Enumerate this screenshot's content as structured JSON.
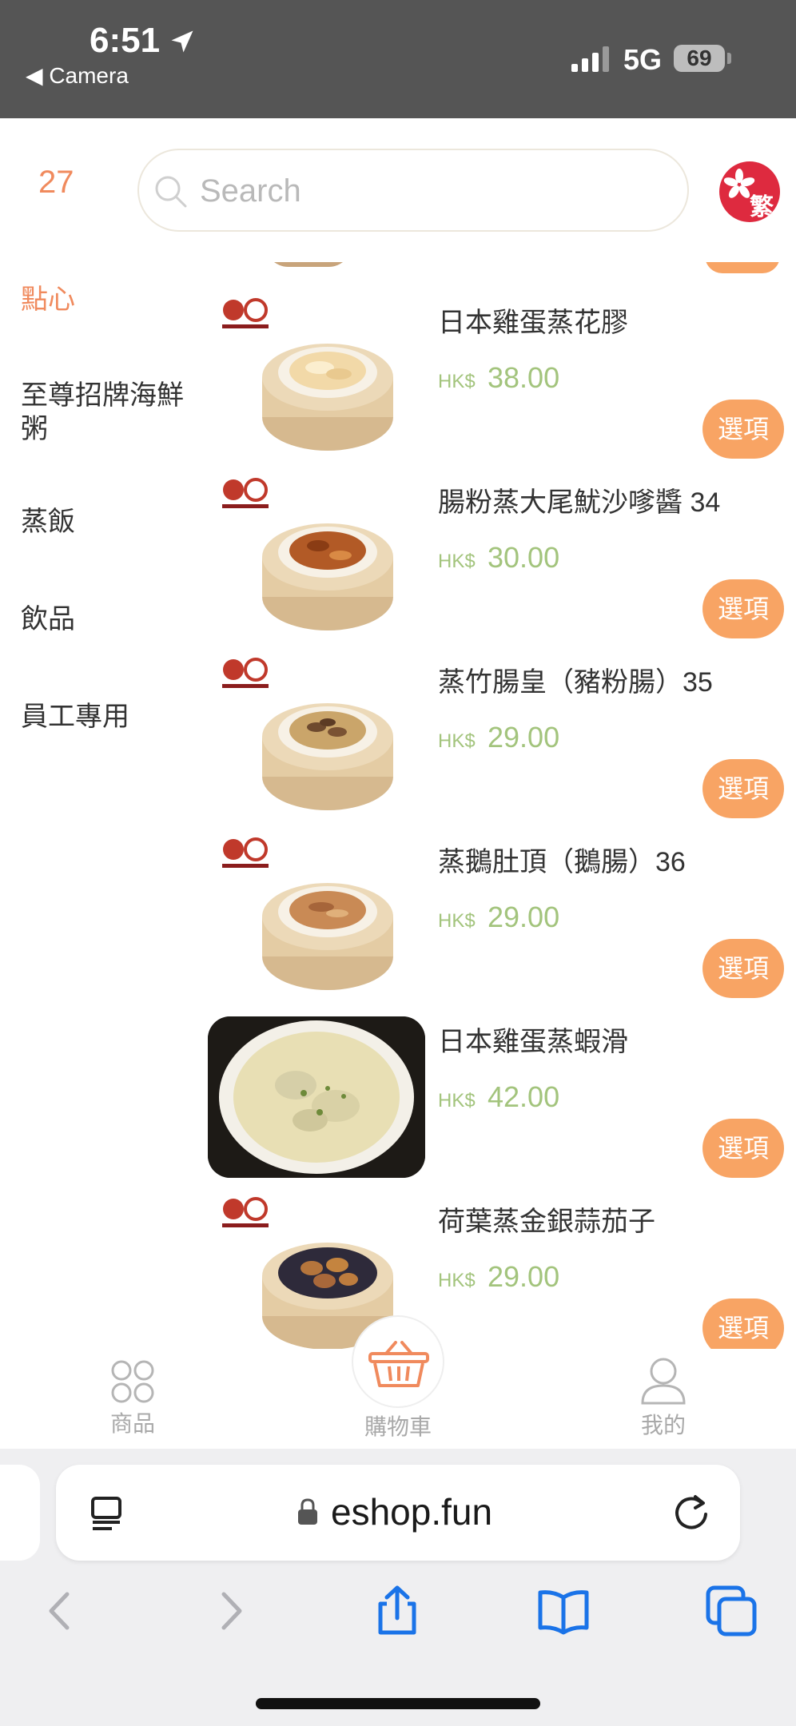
{
  "status_bar": {
    "time": "6:51",
    "back_app": "◀ Camera",
    "network": "5G",
    "battery": "69"
  },
  "header": {
    "cart_count": "27",
    "search_placeholder": "Search",
    "language": "繁"
  },
  "categories": [
    {
      "label": "點心",
      "active": true
    },
    {
      "label": "至尊招牌海鮮粥",
      "active": false
    },
    {
      "label": "蒸飯",
      "active": false
    },
    {
      "label": "飲品",
      "active": false
    },
    {
      "label": "員工專用",
      "active": false
    }
  ],
  "products": [
    {
      "name": "日本雞蛋蒸花膠",
      "currency": "HK$",
      "price": "38.00",
      "button": "選項"
    },
    {
      "name": "腸粉蒸大尾魷沙嗲醬 34",
      "currency": "HK$",
      "price": "30.00",
      "button": "選項"
    },
    {
      "name": "蒸竹腸皇（豬粉腸）35",
      "currency": "HK$",
      "price": "29.00",
      "button": "選項"
    },
    {
      "name": "蒸鵝肚頂（鵝腸）36",
      "currency": "HK$",
      "price": "29.00",
      "button": "選項"
    },
    {
      "name": "日本雞蛋蒸蝦滑",
      "currency": "HK$",
      "price": "42.00",
      "button": "選項"
    },
    {
      "name": "荷葉蒸金銀蒜茄子",
      "currency": "HK$",
      "price": "29.00",
      "button": "選項"
    }
  ],
  "tabbar": {
    "products": "商品",
    "cart": "購物車",
    "me": "我的"
  },
  "browser": {
    "url": "eshop.fun"
  },
  "colors": {
    "accent": "#f08a5d",
    "button": "#f8a464",
    "price": "#a3c47d",
    "status_bar": "#555555"
  },
  "icons": [
    "location-arrow-icon",
    "signal-icon",
    "search-icon",
    "hk-flag-icon",
    "grid-icon",
    "basket-icon",
    "person-icon",
    "reader-icon",
    "lock-icon",
    "reload-icon",
    "back-icon",
    "forward-icon",
    "share-icon",
    "bookmarks-icon",
    "tabs-icon"
  ]
}
